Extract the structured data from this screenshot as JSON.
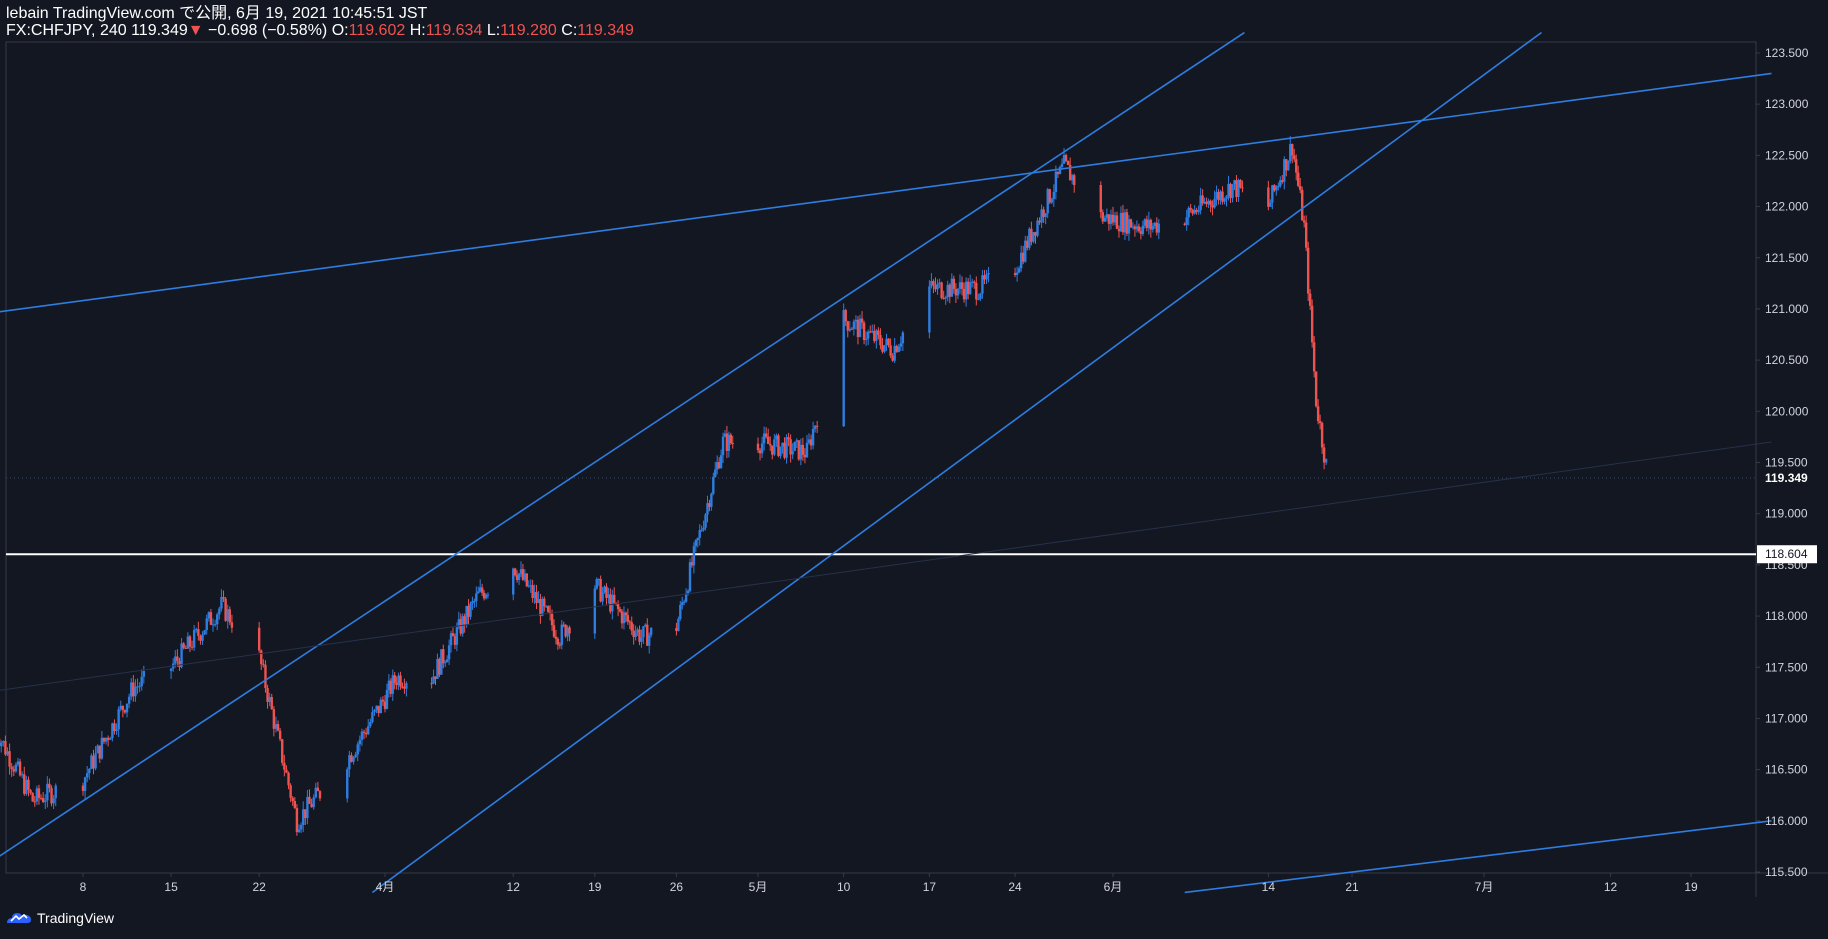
{
  "header": {
    "publish_line": "lebain TradingView.com で公開, 6月 19, 2021 10:45:51 JST",
    "symbol": "FX:CHFJPY, 240",
    "last": "119.349",
    "change_arrow": "▼",
    "change": "−0.698 (−0.58%)",
    "o_label": "O:",
    "o_value": "119.602",
    "h_label": "H:",
    "h_value": "119.634",
    "l_label": "L:",
    "l_value": "119.280",
    "c_label": "C:",
    "c_value": "119.349"
  },
  "footer": {
    "brand": "TradingView",
    "logo_icon": "tradingview-logo-icon"
  },
  "colors": {
    "background": "#131722",
    "up": "#2e7de0",
    "down": "#ef5350",
    "trendline": "#2e7de0",
    "hline": "#ffffff",
    "axis_text": "#d1d4dc",
    "axis_border": "#363a45"
  },
  "chart_data": {
    "type": "candlestick",
    "title": "FX:CHFJPY, 240",
    "x_tick_labels": [
      "8",
      "15",
      "22",
      "4月",
      "12",
      "19",
      "26",
      "5月",
      "10",
      "17",
      "24",
      "6月",
      "14",
      "21",
      "7月",
      "12",
      "19"
    ],
    "y_tick_labels": [
      "115.500",
      "116.000",
      "116.500",
      "117.000",
      "117.500",
      "118.000",
      "118.500",
      "119.000",
      "119.500",
      "120.000",
      "120.500",
      "121.000",
      "121.500",
      "122.000",
      "122.500",
      "123.000",
      "123.500"
    ],
    "ylim": [
      115.25,
      123.7
    ],
    "grid": false,
    "last_price": 119.349,
    "horizontal_line": 118.604,
    "close_path_approx": [
      {
        "date": "2021-03-01",
        "close": 116.9
      },
      {
        "date": "2021-03-04",
        "close": 116.2
      },
      {
        "date": "2021-03-08",
        "close": 116.4
      },
      {
        "date": "2021-03-12",
        "close": 117.3
      },
      {
        "date": "2021-03-15",
        "close": 117.5
      },
      {
        "date": "2021-03-19",
        "close": 118.1
      },
      {
        "date": "2021-03-22",
        "close": 117.6
      },
      {
        "date": "2021-03-25",
        "close": 116.0
      },
      {
        "date": "2021-03-29",
        "close": 116.6
      },
      {
        "date": "2021-04-02",
        "close": 117.4
      },
      {
        "date": "2021-04-05",
        "close": 117.4
      },
      {
        "date": "2021-04-09",
        "close": 118.2
      },
      {
        "date": "2021-04-12",
        "close": 118.5
      },
      {
        "date": "2021-04-16",
        "close": 117.8
      },
      {
        "date": "2021-04-19",
        "close": 118.3
      },
      {
        "date": "2021-04-23",
        "close": 117.8
      },
      {
        "date": "2021-04-26",
        "close": 117.9
      },
      {
        "date": "2021-04-30",
        "close": 119.7
      },
      {
        "date": "2021-05-03",
        "close": 119.7
      },
      {
        "date": "2021-05-07",
        "close": 119.6
      },
      {
        "date": "2021-05-10",
        "close": 120.9
      },
      {
        "date": "2021-05-14",
        "close": 120.6
      },
      {
        "date": "2021-05-17",
        "close": 121.2
      },
      {
        "date": "2021-05-21",
        "close": 121.2
      },
      {
        "date": "2021-05-24",
        "close": 121.4
      },
      {
        "date": "2021-05-28",
        "close": 122.4
      },
      {
        "date": "2021-05-31",
        "close": 121.9
      },
      {
        "date": "2021-06-04",
        "close": 121.8
      },
      {
        "date": "2021-06-07",
        "close": 121.9
      },
      {
        "date": "2021-06-11",
        "close": 122.2
      },
      {
        "date": "2021-06-14",
        "close": 122.0
      },
      {
        "date": "2021-06-16",
        "close": 122.6
      },
      {
        "date": "2021-06-17",
        "close": 121.8
      },
      {
        "date": "2021-06-18",
        "close": 120.1
      },
      {
        "date": "2021-06-19",
        "close": 119.349
      }
    ],
    "trendlines_approx": [
      {
        "name": "channel-upper",
        "from": {
          "date": "2021-02-25",
          "price": 115.3
        },
        "to": {
          "date": "2021-06-12",
          "price": 123.7
        }
      },
      {
        "name": "channel-lower",
        "from": {
          "date": "2021-03-31",
          "price": 115.3
        },
        "to": {
          "date": "2021-07-06",
          "price": 123.7
        }
      },
      {
        "name": "resistance",
        "from": {
          "date": "2021-02-25",
          "price": 120.9
        },
        "to": {
          "date": "2021-07-26",
          "price": 123.3
        }
      },
      {
        "name": "support",
        "from": {
          "date": "2021-06-07",
          "price": 115.3
        },
        "to": {
          "date": "2021-07-26",
          "price": 116.0
        }
      },
      {
        "name": "faint-line",
        "from": {
          "date": "2021-02-25",
          "price": 117.2
        },
        "to": {
          "date": "2021-07-26",
          "price": 119.7
        }
      }
    ]
  }
}
